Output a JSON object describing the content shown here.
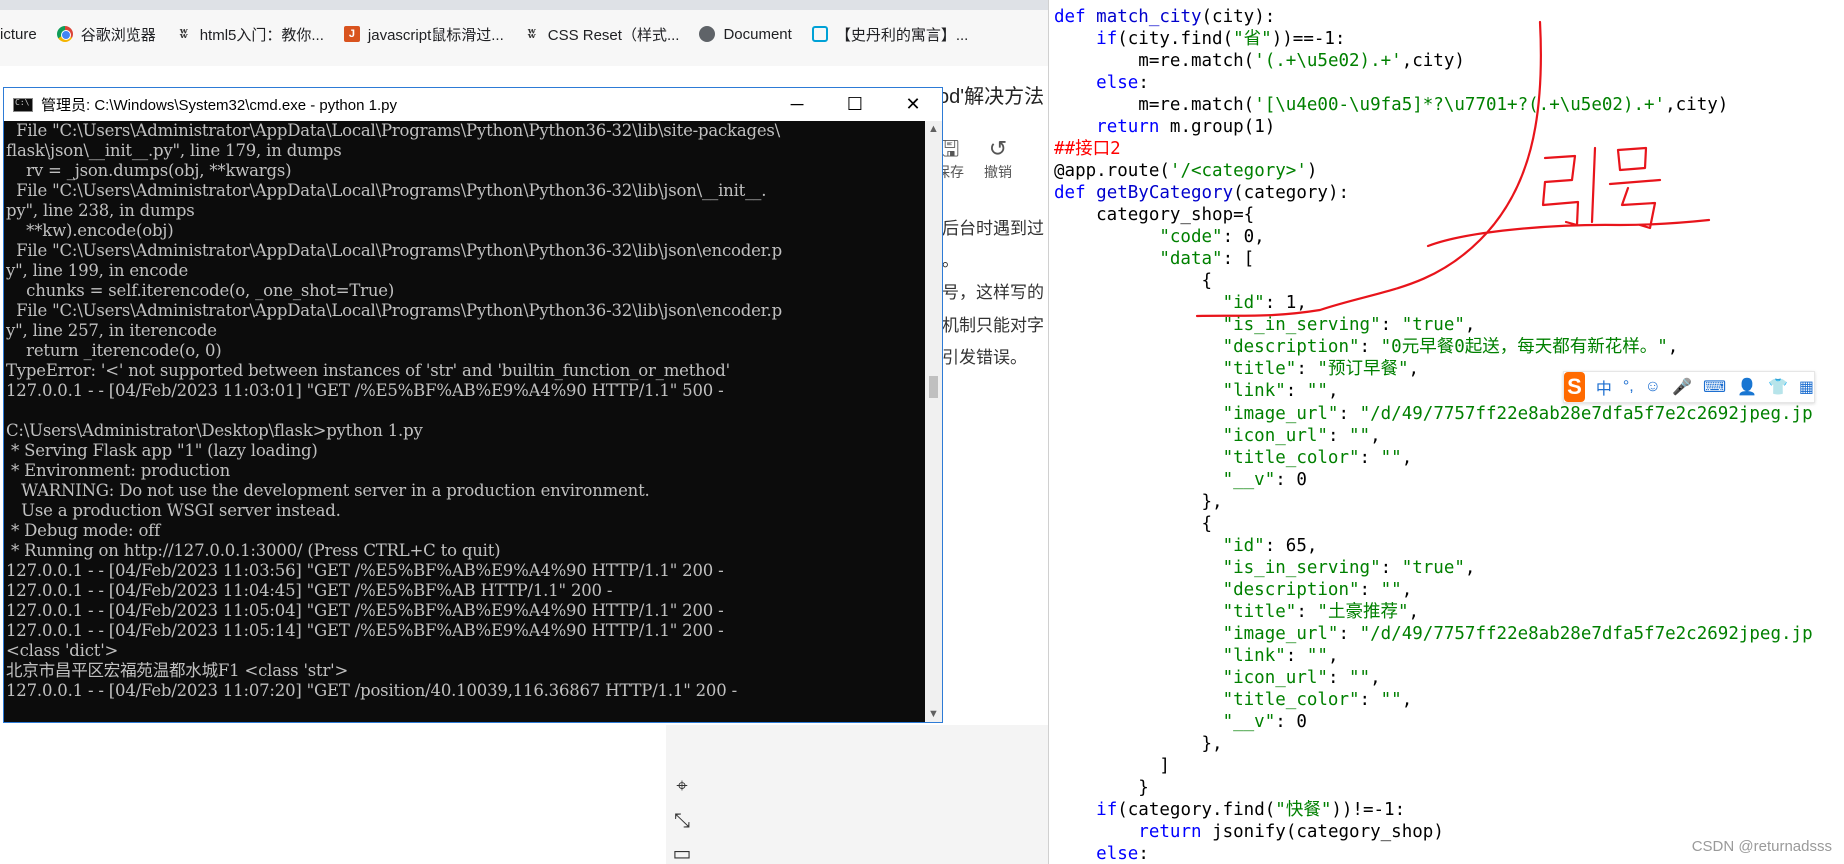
{
  "bookmarks": [
    {
      "label": "icture",
      "icon": "none"
    },
    {
      "label": "谷歌浏览器",
      "icon": "chrome-icon"
    },
    {
      "label": "html5入门：教你...",
      "icon": "w3-icon"
    },
    {
      "label": "javascript鼠标滑过...",
      "icon": "js-icon"
    },
    {
      "label": "CSS Reset（样式...",
      "icon": "w3-icon"
    },
    {
      "label": "Document",
      "icon": "globe-icon"
    },
    {
      "label": "【史丹利的寓言】...",
      "icon": "bilibili-icon"
    }
  ],
  "background_page": {
    "title_fragment": "od'解决方法",
    "toolbar": {
      "save_label": "保存",
      "undo_label": "撤销"
    },
    "text_lines": [
      "后台时遇到过",
      "。",
      "号，这样写的",
      "机制只能对字",
      "引发错误。"
    ]
  },
  "cmd": {
    "title": "管理员: C:\\Windows\\System32\\cmd.exe - python  1.py",
    "lines": [
      "  File \"C:\\Users\\Administrator\\AppData\\Local\\Programs\\Python\\Python36-32\\lib\\site-packages\\",
      "flask\\json\\__init__.py\", line 179, in dumps",
      "    rv = _json.dumps(obj, **kwargs)",
      "  File \"C:\\Users\\Administrator\\AppData\\Local\\Programs\\Python\\Python36-32\\lib\\json\\__init__.",
      "py\", line 238, in dumps",
      "    **kw).encode(obj)",
      "  File \"C:\\Users\\Administrator\\AppData\\Local\\Programs\\Python\\Python36-32\\lib\\json\\encoder.p",
      "y\", line 199, in encode",
      "    chunks = self.iterencode(o, _one_shot=True)",
      "  File \"C:\\Users\\Administrator\\AppData\\Local\\Programs\\Python\\Python36-32\\lib\\json\\encoder.p",
      "y\", line 257, in iterencode",
      "    return _iterencode(o, 0)",
      "TypeError: '<' not supported between instances of 'str' and 'builtin_function_or_method'",
      "127.0.0.1 - - [04/Feb/2023 11:03:01] \"GET /%E5%BF%AB%E9%A4%90 HTTP/1.1\" 500 -",
      "",
      "C:\\Users\\Administrator\\Desktop\\flask>python 1.py",
      " * Serving Flask app \"1\" (lazy loading)",
      " * Environment: production",
      "   WARNING: Do not use the development server in a production environment.",
      "   Use a production WSGI server instead.",
      " * Debug mode: off",
      " * Running on http://127.0.0.1:3000/ (Press CTRL+C to quit)",
      "127.0.0.1 - - [04/Feb/2023 11:03:56] \"GET /%E5%BF%AB%E9%A4%90 HTTP/1.1\" 200 -",
      "127.0.0.1 - - [04/Feb/2023 11:04:45] \"GET /%E5%BF%AB HTTP/1.1\" 200 -",
      "127.0.0.1 - - [04/Feb/2023 11:05:04] \"GET /%E5%BF%AB%E9%A4%90 HTTP/1.1\" 200 -",
      "127.0.0.1 - - [04/Feb/2023 11:05:14] \"GET /%E5%BF%AB%E9%A4%90 HTTP/1.1\" 200 -",
      "<class 'dict'>",
      "北京市昌平区宏福苑温都水城F1 <class 'str'>",
      "127.0.0.1 - - [04/Feb/2023 11:07:20] \"GET /position/40.10039,116.36867 HTTP/1.1\" 200 -"
    ]
  },
  "editor": {
    "lines": [
      [
        [
          "kw",
          "def "
        ],
        [
          "fn",
          "match_city"
        ],
        [
          "",
          "(city):"
        ]
      ],
      [
        [
          "",
          "    "
        ],
        [
          "kw",
          "if"
        ],
        [
          "",
          "(city.find("
        ],
        [
          "str",
          "\"省\""
        ],
        [
          "",
          "))==-1:"
        ]
      ],
      [
        [
          "",
          "        m=re.match("
        ],
        [
          "str",
          "'(.+\\u5e02).+'"
        ],
        [
          "",
          ",city)"
        ]
      ],
      [
        [
          "",
          "    "
        ],
        [
          "kw",
          "else"
        ],
        [
          "",
          ":"
        ]
      ],
      [
        [
          "",
          "        m=re.match("
        ],
        [
          "str",
          "'[\\u4e00-\\u9fa5]*?\\u7701+?(.+\\u5e02).+'"
        ],
        [
          "",
          ",city)"
        ]
      ],
      [
        [
          "",
          "    "
        ],
        [
          "kw",
          "return "
        ],
        [
          "",
          "m.group(1)"
        ]
      ],
      [
        [
          "cm",
          "##接口2"
        ]
      ],
      [
        [
          "",
          "@app.route("
        ],
        [
          "str",
          "'/<category>'"
        ],
        [
          "",
          ")"
        ]
      ],
      [
        [
          "kw",
          "def "
        ],
        [
          "fn",
          "getByCategory"
        ],
        [
          "",
          "(category):"
        ]
      ],
      [
        [
          "",
          "    category_shop={"
        ]
      ],
      [
        [
          "",
          "          "
        ],
        [
          "str",
          "\"code\""
        ],
        [
          "",
          ": 0,"
        ]
      ],
      [
        [
          "",
          "          "
        ],
        [
          "str",
          "\"data\""
        ],
        [
          "",
          ": ["
        ]
      ],
      [
        [
          "",
          "              {"
        ]
      ],
      [
        [
          "",
          "                "
        ],
        [
          "str",
          "\"id\""
        ],
        [
          "",
          ": 1,"
        ]
      ],
      [
        [
          "",
          "                "
        ],
        [
          "str",
          "\"is_in_serving\""
        ],
        [
          "",
          ": "
        ],
        [
          "str",
          "\"true\""
        ],
        [
          "",
          ","
        ]
      ],
      [
        [
          "",
          "                "
        ],
        [
          "str",
          "\"description\""
        ],
        [
          "",
          ": "
        ],
        [
          "str",
          "\"0元早餐0起送，每天都有新花样。\""
        ],
        [
          "",
          ","
        ]
      ],
      [
        [
          "",
          "                "
        ],
        [
          "str",
          "\"title\""
        ],
        [
          "",
          ": "
        ],
        [
          "str",
          "\"预订早餐\""
        ],
        [
          "",
          ","
        ]
      ],
      [
        [
          "",
          "                "
        ],
        [
          "str",
          "\"link\""
        ],
        [
          "",
          ": "
        ],
        [
          "str",
          "\"\""
        ],
        [
          "",
          ","
        ]
      ],
      [
        [
          "",
          "                "
        ],
        [
          "str",
          "\"image_url\""
        ],
        [
          "",
          ": "
        ],
        [
          "str",
          "\"/d/49/7757ff22e8ab28e7dfa5f7e2c2692jpeg.jp"
        ]
      ],
      [
        [
          "",
          "                "
        ],
        [
          "str",
          "\"icon_url\""
        ],
        [
          "",
          ": "
        ],
        [
          "str",
          "\"\""
        ],
        [
          "",
          ","
        ]
      ],
      [
        [
          "",
          "                "
        ],
        [
          "str",
          "\"title_color\""
        ],
        [
          "",
          ": "
        ],
        [
          "str",
          "\"\""
        ],
        [
          "",
          ","
        ]
      ],
      [
        [
          "",
          "                "
        ],
        [
          "str",
          "\"__v\""
        ],
        [
          "",
          ": 0"
        ]
      ],
      [
        [
          "",
          "              },"
        ]
      ],
      [
        [
          "",
          "              {"
        ]
      ],
      [
        [
          "",
          "                "
        ],
        [
          "str",
          "\"id\""
        ],
        [
          "",
          ": 65,"
        ]
      ],
      [
        [
          "",
          "                "
        ],
        [
          "str",
          "\"is_in_serving\""
        ],
        [
          "",
          ": "
        ],
        [
          "str",
          "\"true\""
        ],
        [
          "",
          ","
        ]
      ],
      [
        [
          "",
          "                "
        ],
        [
          "str",
          "\"description\""
        ],
        [
          "",
          ": "
        ],
        [
          "str",
          "\"\""
        ],
        [
          "",
          ","
        ]
      ],
      [
        [
          "",
          "                "
        ],
        [
          "str",
          "\"title\""
        ],
        [
          "",
          ": "
        ],
        [
          "str",
          "\"土豪推荐\""
        ],
        [
          "",
          ","
        ]
      ],
      [
        [
          "",
          "                "
        ],
        [
          "str",
          "\"image_url\""
        ],
        [
          "",
          ": "
        ],
        [
          "str",
          "\"/d/49/7757ff22e8ab28e7dfa5f7e2c2692jpeg.jp"
        ]
      ],
      [
        [
          "",
          "                "
        ],
        [
          "str",
          "\"link\""
        ],
        [
          "",
          ": "
        ],
        [
          "str",
          "\"\""
        ],
        [
          "",
          ","
        ]
      ],
      [
        [
          "",
          "                "
        ],
        [
          "str",
          "\"icon_url\""
        ],
        [
          "",
          ": "
        ],
        [
          "str",
          "\"\""
        ],
        [
          "",
          ","
        ]
      ],
      [
        [
          "",
          "                "
        ],
        [
          "str",
          "\"title_color\""
        ],
        [
          "",
          ": "
        ],
        [
          "str",
          "\"\""
        ],
        [
          "",
          ","
        ]
      ],
      [
        [
          "",
          "                "
        ],
        [
          "str",
          "\"__v\""
        ],
        [
          "",
          ": 0"
        ]
      ],
      [
        [
          "",
          "              },"
        ]
      ],
      [
        [
          "",
          "          ]"
        ]
      ],
      [
        [
          "",
          "        }"
        ]
      ],
      [
        [
          "",
          "    "
        ],
        [
          "kw",
          "if"
        ],
        [
          "",
          "(category.find("
        ],
        [
          "str",
          "\"快餐\""
        ],
        [
          "",
          "))!=-1:"
        ]
      ],
      [
        [
          "",
          "        "
        ],
        [
          "kw",
          "return "
        ],
        [
          "",
          "jsonify(category_shop)"
        ]
      ],
      [
        [
          "",
          "    "
        ],
        [
          "kw",
          "else"
        ],
        [
          "",
          ":"
        ]
      ]
    ]
  },
  "ime_toolbar": {
    "logo": "S",
    "items": [
      "中",
      "°,",
      "☺",
      "🎤",
      "⌨",
      "👤",
      "👕",
      "▦"
    ]
  },
  "annotation": {
    "text": "引号",
    "color": "#e8141b"
  },
  "watermark": "CSDN @returnadsss",
  "colors": {
    "keyword": "#0000ff",
    "string": "#008000",
    "comment": "#ff0000",
    "annotation": "#e8141b"
  }
}
